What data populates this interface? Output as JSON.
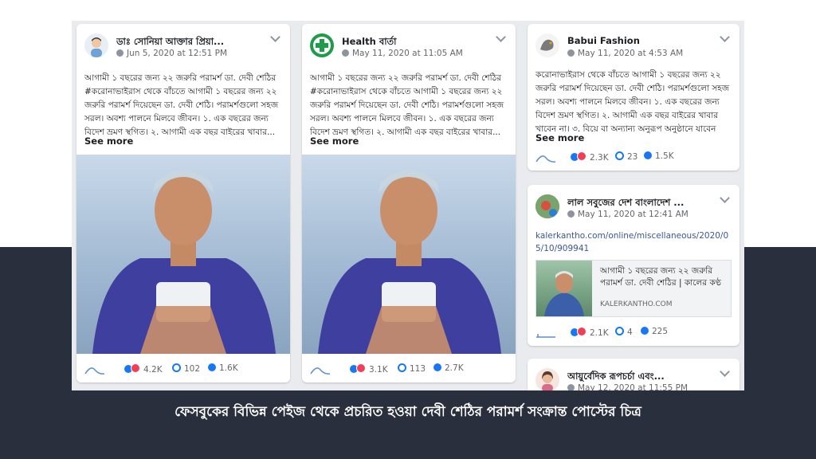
{
  "posts": [
    {
      "page_name": "ডাঃ সোনিয়া আক্তার প্রিয়া...",
      "date": "Jun 5, 2020 at 12:51 PM",
      "text": "আগামী ১ বছরের জন্য ২২ জরুরি পরামর্শ ডা. দেবী শেঠির #করোনাভাইরাস থেকে বাঁচতে আগামী ১ বছরের জন্য ২২ জরুরি পরামর্শ দিয়েছেন ডা. দেবী শেঠি। পরামর্শগুলো সহজ সরল। অবশ্য পালনে মিলবে জীবন। ১. এক বছরের জন্য বিদেশ ভ্রমণ স্থগিত। ২. আগামী এক বছর বাইরের খাবার...",
      "see_more": "See more",
      "reactions": "4.2K",
      "comments": "102",
      "shares": "1.6K",
      "avatar_icon": "doctor-avatar-icon"
    },
    {
      "page_name": "Health বার্তা",
      "date": "May 11, 2020 at 11:05 AM",
      "text": "আগামী ১ বছরের জন্য ২২ জরুরি পরামর্শ ডা. দেবী শেঠির #করোনাভাইরাস থেকে বাঁচতে আগামী ১ বছরের জন্য ২২ জরুরি পরামর্শ দিয়েছেন ডা. দেবী শেঠি। পরামর্শগুলো সহজ সরল। অবশ্য পালনে মিলবে জীবন। ১. এক বছরের জন্য বিদেশ ভ্রমণ স্থগিত। ২. আগামী এক বছর বাইরের খাবার...",
      "see_more": "See more",
      "reactions": "3.1K",
      "comments": "113",
      "shares": "2.7K",
      "avatar_icon": "medical-cross-icon"
    },
    {
      "page_name": "Babui Fashion",
      "date": "May 11, 2020 at 4:53 AM",
      "text": "করোনাভাইরাস থেকে বাঁচতে আগামী ১ বছরের জন্য ২২ জরুরি পরামর্শ দিয়েছেন ডা. দেবী শেঠি। পরামর্শগুলো সহজ সরল। অবশ্য পালনে মিলবে জীবন। ১. এক বছরের জন্য বিদেশ ভ্রমণ স্থগিত। ২. আগামী এক বছর বাইরের খাবার খাবেন না। ৩. বিয়ে বা অন্যান্য অনুরূপ অনুষ্ঠানে যাবেন না।...",
      "see_more": "See more",
      "reactions": "2.3K",
      "comments": "23",
      "shares": "1.5K",
      "avatar_icon": "bird-logo-icon"
    },
    {
      "page_name": "লাল সবুজের দেশ বাংলাদেশ ...",
      "date": "May 11, 2020 at 12:41 AM",
      "link_url": "kalerkantho.com/online/miscellaneous/2020/05/10/909941",
      "link_title": "আগামী ১ বছরের জন্য ২২ জরুরি পরামর্শ ডা. দেবী শেঠির | কালের কণ্ঠ",
      "link_domain": "KALERKANTHO.COM",
      "reactions": "2.1K",
      "comments": "4",
      "shares": "225",
      "avatar_icon": "flag-avatar-icon"
    },
    {
      "page_name": "আয়ুর্বেদিক রূপচর্চা এবং...",
      "date": "May 12, 2020 at 11:55 PM",
      "avatar_icon": "woman-avatar-icon"
    }
  ],
  "caption": "ফেসবুকের বিভিন্ন পেইজ থেকে প্রচরিত হওয়া দেবী শেঠির পরামর্শ সংক্রান্ত পোস্টের চিত্র",
  "colors": {
    "reaction_blue": "#1877f2",
    "reaction_red": "#f33e58",
    "link_blue": "#385898",
    "dark_band": "#2a2f3d"
  }
}
